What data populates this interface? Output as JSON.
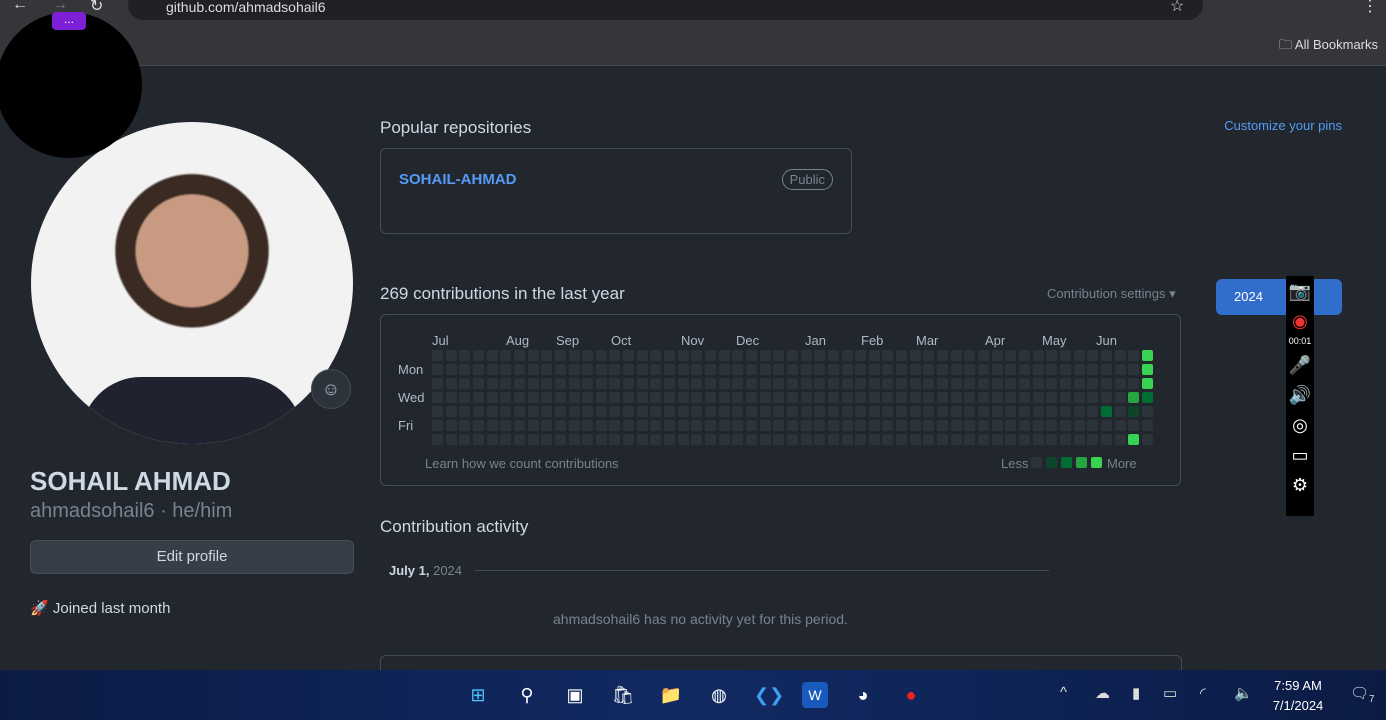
{
  "browser": {
    "url": "github.com/ahmadsohail6",
    "bookmarks_label": "All Bookmarks",
    "recorder_badge": "..."
  },
  "profile": {
    "name": "SOHAIL AHMAD",
    "login": "ahmadsohail6 · he/him",
    "edit_label": "Edit profile",
    "joined": "Joined last month"
  },
  "pins": {
    "title": "Popular repositories",
    "customize": "Customize your pins",
    "repos": [
      {
        "name": "SOHAIL-AHMAD",
        "visibility": "Public"
      }
    ]
  },
  "contrib": {
    "title": "269 contributions in the last year",
    "settings": "Contribution settings ▾",
    "months": [
      "Jul",
      "Aug",
      "Sep",
      "Oct",
      "Nov",
      "Dec",
      "Jan",
      "Feb",
      "Mar",
      "Apr",
      "May",
      "Jun"
    ],
    "days": [
      "Mon",
      "Wed",
      "Fri"
    ],
    "learn": "Learn how we count contributions",
    "less": "Less",
    "more": "More",
    "colors": [
      "#2d333b",
      "#0e4429",
      "#006d32",
      "#26a641",
      "#39d353"
    ],
    "active_cells": [
      [
        52,
        0,
        4
      ],
      [
        52,
        1,
        4
      ],
      [
        52,
        2,
        4
      ],
      [
        52,
        3,
        2
      ],
      [
        51,
        3,
        3
      ],
      [
        51,
        4,
        1
      ],
      [
        51,
        6,
        4
      ],
      [
        49,
        4,
        2
      ]
    ],
    "year": "2024"
  },
  "activity": {
    "title": "Contribution activity",
    "date_bold": "July 1,",
    "date_year": "2024",
    "empty": "ahmadsohail6 has no activity yet for this period."
  },
  "recorder": {
    "timer": "00:01"
  },
  "taskbar": {
    "time": "7:59 AM",
    "date": "7/1/2024",
    "notifications": "7"
  }
}
